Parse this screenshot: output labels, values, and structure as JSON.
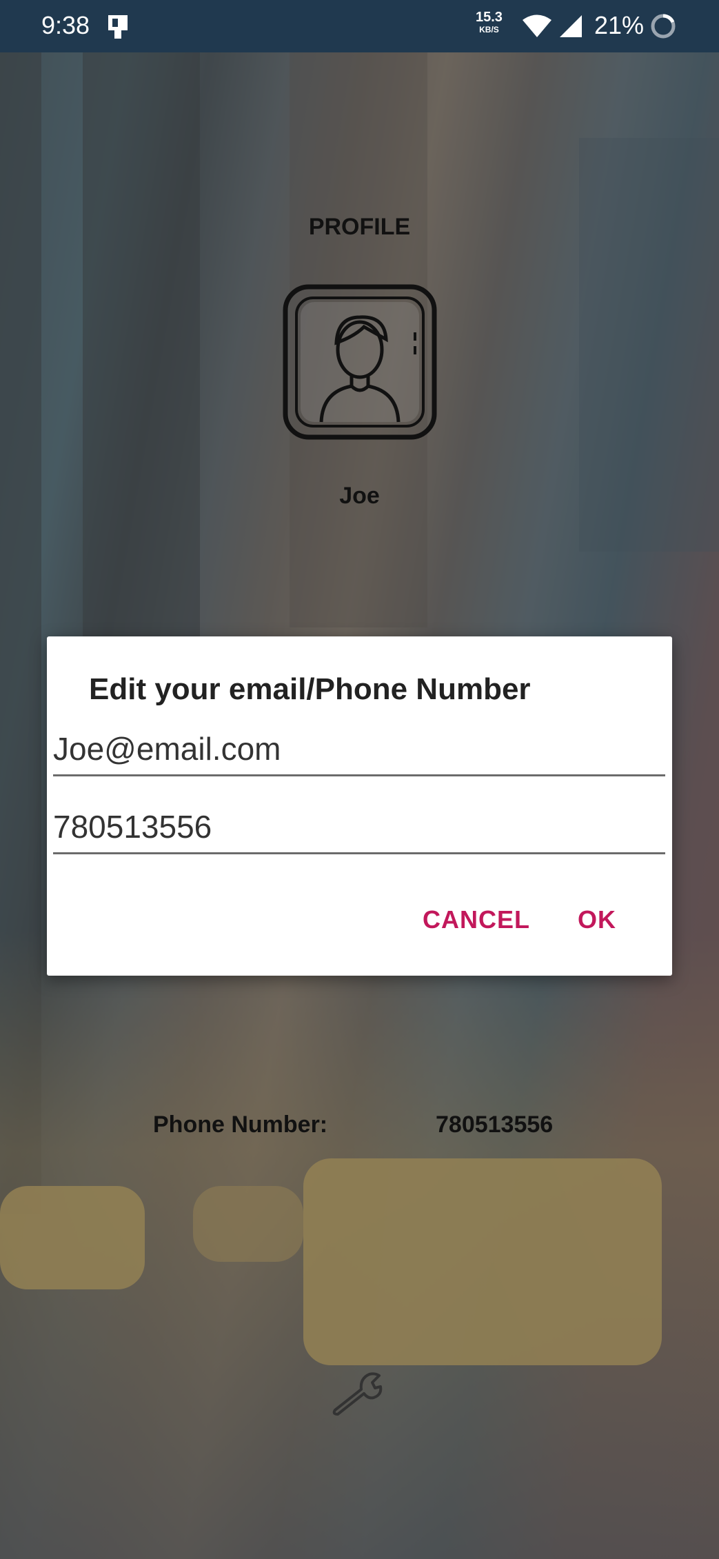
{
  "status_bar": {
    "time": "9:38",
    "network_speed": "15.3",
    "network_speed_unit": "KB/S",
    "battery": "21%",
    "icons": [
      "notification-icon",
      "wifi-icon",
      "signal-icon",
      "battery-circle-icon"
    ]
  },
  "profile": {
    "title": "PROFILE",
    "avatar_icon": "user-avatar-icon",
    "name": "Joe",
    "phone_label": "Phone Number:",
    "phone_value": "780513556",
    "settings_icon": "wrench-icon"
  },
  "dialog": {
    "title": "Edit your email/Phone Number",
    "email_value": "Joe@email.com",
    "phone_value": "780513556",
    "cancel_label": "CANCEL",
    "ok_label": "OK",
    "accent_color": "#c2185b"
  }
}
